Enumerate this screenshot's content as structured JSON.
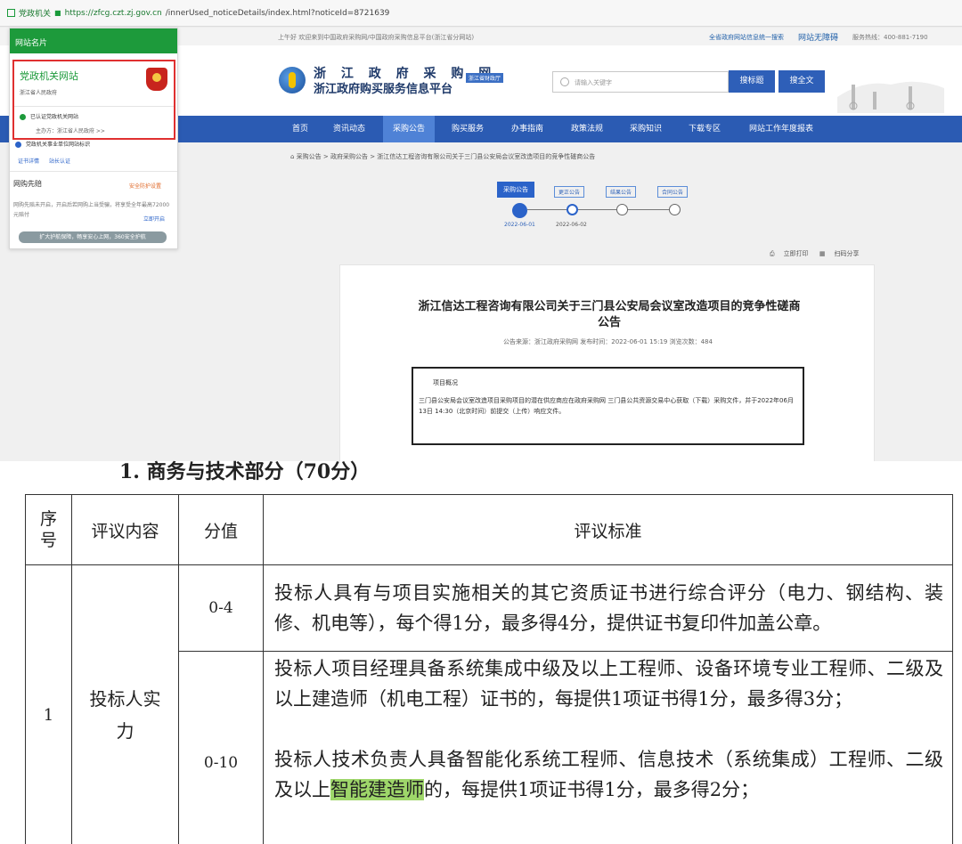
{
  "browser": {
    "tab_label": "党政机关",
    "url_host": "https://zfcg.czt.zj.gov.cn",
    "url_path": "/innerUsed_noticeDetails/index.html?noticeId=8721639"
  },
  "site": {
    "topbar": {
      "welcome": "上午好 欢迎来到中国政府采购网/中国政府采购信息平台(浙江省分网站)",
      "search_link": "全省政府网站信息统一搜索",
      "accessibility": "网站无障碍",
      "hotline": "服务热线：400-881-7190"
    },
    "logo": {
      "line1": "浙 江 政 府 采 购 网",
      "line2": "浙江政府购买服务信息平台",
      "tag": "浙江省财政厅"
    },
    "search": {
      "placeholder": "请输入关键字",
      "btn_title": "搜标题",
      "btn_full": "搜全文"
    },
    "nav": [
      "首页",
      "资讯动态",
      "采购公告",
      "购买服务",
      "办事指南",
      "政策法规",
      "采购知识",
      "下载专区",
      "网站工作年度报表"
    ],
    "breadcrumb": "采购公告 > 政府采购公告 > 浙江信达工程咨询有限公司关于三门县公安局会议室改造项目的竞争性磋商公告",
    "progress": {
      "steps": [
        "采购公告",
        "更正公告",
        "结果公告",
        "合同公告"
      ],
      "dates": [
        "2022-06-01",
        "2022-06-02"
      ]
    },
    "tools": {
      "print": "立即打印",
      "share": "扫码分享"
    },
    "doc": {
      "title": "浙江信达工程咨询有限公司关于三门县公安局会议室改造项目的竞争性磋商公告",
      "meta": "公告来源：浙江政府采购网    发布时间：2022-06-01 15:19    浏览次数：484",
      "box_heading": "项目概况",
      "box_text": "三门县公安局会议室改造项目采购项目的潜在供应商应在政府采购网 三门县公共资源交易中心获取（下载）采购文件，并于2022年06月13日 14:30（北京时间）前提交（上传）响应文件。"
    }
  },
  "popup": {
    "header": "网站名片",
    "site_name": "党政机关网站",
    "gov": "浙江省人民政府",
    "verified": "已认证党政机关网站",
    "sponsor": "主办方：浙江省人民政府 >>",
    "info": "党政机关事业单位网站标识",
    "links": [
      "证书详情",
      "站长认证"
    ],
    "section": "网购先赔",
    "safe": "安全防护设置",
    "desc": "网购先赔未开启，开启后若网购上当受骗，将享受全年最高72000元赔付",
    "open": "立即开启",
    "banner": "扩大护航保障，畅享安心上网，360安全护航"
  },
  "document": {
    "section_heading": "1. 商务与技术部分（70分）",
    "headers": [
      "序号",
      "评议内容",
      "分值",
      "评议标准"
    ],
    "row1_num": "1",
    "row1_content": "投标人实力",
    "score_a": "0-4",
    "crit_a": "投标人具有与项目实施相关的其它资质证书进行综合评分（电力、钢结构、装修、机电等），每个得1分，最多得4分，提供证书复印件加盖公章。",
    "score_b": "0-10",
    "crit_b1": "投标人项目经理具备系统集成中级及以上工程师、设备环境专业工程师、二级及以上建造师（机电工程）证书的，每提供1项证书得1分，最多得3分；",
    "crit_b2_pre": "投标人技术负责人具备智能化系统工程师、信息技术（系统集成）工程师、二级及以上",
    "crit_b2_hl": "智能建造师",
    "crit_b2_post": "的，每提供1项证书得1分，最多得2分；"
  },
  "colors": {
    "nav_blue": "#2b5bb3",
    "green": "#1d9a3b",
    "highlight": "#9ed66a",
    "red_frame": "#e03030"
  }
}
